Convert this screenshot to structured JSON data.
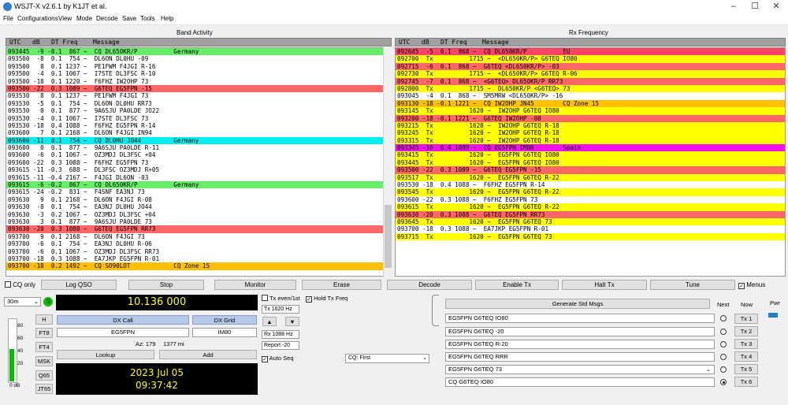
{
  "window": {
    "title": "WSJT-X  v2.6.1  by K1JT et al."
  },
  "menu": [
    "File",
    "Configurations",
    "View",
    "Mode",
    "Decode",
    "Save",
    "Tools",
    "Help"
  ],
  "band_activity": {
    "title": "Band Activity",
    "header": "UTC   dB   DT Freq    Message",
    "rows": [
      {
        "t": "093445  -9 -0.1  867 ~  CQ DL650KR/P          Germany",
        "c": "green"
      },
      {
        "t": "093500  -8  0.1  754 ~  DL6ON DL0HU -09",
        "c": ""
      },
      {
        "t": "093500   8  0.1 1237 ~  PE1FWM F4JGI R-16",
        "c": ""
      },
      {
        "t": "093500  -4  0.1 1067 ~  I7STE DL3FSC R-10",
        "c": ""
      },
      {
        "t": "093500 -18  0.1 1220 ~  F6FHZ IW2OHP 73",
        "c": ""
      },
      {
        "t": "093500 -22  0.3 1089 ~  G6TEQ EG5FPN -15",
        "c": "red"
      },
      {
        "t": "093530   8  0.1 1237 ~  PE1FWM F4JGI 73",
        "c": ""
      },
      {
        "t": "093530  -5  0.1  754 ~  DL6ON DL0HU RR73",
        "c": ""
      },
      {
        "t": "093530   0  0.1  877 ~  9A6SJU PA0LDE JO22",
        "c": ""
      },
      {
        "t": "093530  -4  0.1 1067 ~  I7STE DL3FSC 73",
        "c": ""
      },
      {
        "t": "093530 -18  0.4 1088 ~  F6FHZ EG5FPN R-14",
        "c": ""
      },
      {
        "t": "093600   7  0.1 2168 ~  DL6ON F4JGI IN94",
        "c": ""
      },
      {
        "t": "093600 -11  0.1  754 ~  CQ DL0HU JO44         Germany",
        "c": "cyan"
      },
      {
        "t": "093600   0  0.1  877 ~  9A6SJU PA0LDE R-11",
        "c": ""
      },
      {
        "t": "093600  -6  0.1 1067 ~  OZ3MDJ DL3FSC +04",
        "c": ""
      },
      {
        "t": "093600 -22  0.3 1088 ~  F6FHZ EG5FPN 73",
        "c": ""
      },
      {
        "t": "093615 -11 -0.3  688 ~  DL3FSC OZ3MDJ R+05",
        "c": ""
      },
      {
        "t": "093615 -11 -0.4 2167 ~  F4JGI DL6ON -03",
        "c": ""
      },
      {
        "t": "093615  -6 -0.2  867 ~  CQ DL650KR/P          Germany",
        "c": "green"
      },
      {
        "t": "093615 -24 -0.2  831 ~  F4SNF EA3NJ 73",
        "c": ""
      },
      {
        "t": "093630   9  0.1 2168 ~  DL6ON F4JGI R-08",
        "c": ""
      },
      {
        "t": "093630  -8  0.1  754 ~  EA3NJ DL0HU JO44",
        "c": ""
      },
      {
        "t": "093630  -3  0.2 1067 ~  OZ3MDJ DL3FSC +04",
        "c": ""
      },
      {
        "t": "093630   3  0.1  877 ~  9A6SJU PA0LDE 73",
        "c": ""
      },
      {
        "t": "093630 -20  0.3 1088 ~  G6TEQ EG5FPN RR73",
        "c": "red"
      },
      {
        "t": "093700   9  0.1 2168 ~  DL6ON F4JGI 73",
        "c": ""
      },
      {
        "t": "093700  -6  0.1  754 ~  EA3NJ DL0HU R-06",
        "c": ""
      },
      {
        "t": "093700  -6  0.1 1067 ~  OZ3MDJ DL3FSC RR73",
        "c": ""
      },
      {
        "t": "093700 -18  0.3 1088 ~  EA7JKP EG5FPN R-01",
        "c": ""
      },
      {
        "t": "093700 -18  0.2 1492 ~  CQ SO90LOT            CQ Zone 15",
        "c": "orange"
      }
    ]
  },
  "rx_frequency": {
    "title": "Rx Frequency",
    "header": "UTC   dB   DT Freq    Message",
    "rows": [
      {
        "t": "092645  -5  0.1  868 ~  CQ DL650KR/P          EU",
        "c": "pink"
      },
      {
        "t": "092700  Tx          1715 ~  <DL650KR/P> G6TEQ IO80",
        "c": "yellow"
      },
      {
        "t": "092715  -6  0.1  868 ~  G6TEQ <DL650KR/P> -03",
        "c": "red"
      },
      {
        "t": "092730  Tx          1715 ~  <DL650KR/P> G6TEQ R-06",
        "c": "yellow"
      },
      {
        "t": "092745  -7  0.1  868 ~  <G6TEQ> DL650KR/P RR73",
        "c": "red"
      },
      {
        "t": "092800  Tx          1715 ~  DL650KR/P <G6TEQ> 73",
        "c": "yellow"
      },
      {
        "t": "093045  -4  0.1  868 ~  SM5MRW <DL650KR/P> -16",
        "c": ""
      },
      {
        "t": "093130 -18 -0.1 1221 ~  CQ IW2OHP JN45        CQ Zone 15",
        "c": "orange"
      },
      {
        "t": "093145  Tx          1620 ~  IW2OHP G6TEQ IO80",
        "c": "yellow"
      },
      {
        "t": "093200 -18 -0.1 1221 ~  G6TEQ IW2OHP -08",
        "c": "red"
      },
      {
        "t": "093215  Tx          1620 ~  IW2OHP G6TEQ R-18",
        "c": "yellow"
      },
      {
        "t": "093245  Tx          1620 ~  IW2OHP G6TEQ R-18",
        "c": "yellow"
      },
      {
        "t": "093315  Tx          1620 ~  IW2OHP G6TEQ R-18",
        "c": "yellow"
      },
      {
        "t": "093345 -16  0.4 1089 ~  CQ EG5FPN IM80        Spain",
        "c": "magenta"
      },
      {
        "t": "093415  Tx          1620 ~  EG5FPN G6TEQ IO80",
        "c": "yellow"
      },
      {
        "t": "093445  Tx          1620 ~  EG5FPN G6TEQ IO80",
        "c": "yellow"
      },
      {
        "t": "093500 -22  0.3 1089 ~  G6TEQ EG5FPN -15",
        "c": "red"
      },
      {
        "t": "093517  Tx          1620 ~  EG5FPN G6TEQ R-22",
        "c": "yellow"
      },
      {
        "t": "093530 -18  0.4 1088 ~  F6FHZ EG5FPN R-14",
        "c": ""
      },
      {
        "t": "093545  Tx          1620 ~  EG5FPN G6TEQ R-22",
        "c": "yellow"
      },
      {
        "t": "093600 -22  0.3 1088 ~  F6FHZ EG5FPN 73",
        "c": ""
      },
      {
        "t": "093615  Tx          1620 ~  EG5FPN G6TEQ R-22",
        "c": "yellow"
      },
      {
        "t": "093630 -20  0.3 1088 ~  G6TEQ EG5FPN RR73",
        "c": "red"
      },
      {
        "t": "093645  Tx          1620 ~  EG5FPN G6TEQ 73",
        "c": "yellow"
      },
      {
        "t": "093700 -18  0.3 1088 ~  EA7JKP EG5FPN R-01",
        "c": ""
      },
      {
        "t": "093715  Tx          1620 ~  EG5FPN G6TEQ 73",
        "c": "yellow"
      }
    ]
  },
  "buttons": {
    "cq_only": "CQ only",
    "log_qso": "Log QSO",
    "stop": "Stop",
    "monitor": "Monitor",
    "erase": "Erase",
    "decode": "Decode",
    "enable_tx": "Enable Tx",
    "halt_tx": "Halt Tx",
    "tune": "Tune",
    "menus": "Menus"
  },
  "controls": {
    "band": "30m",
    "frequency": "10.136 000",
    "modes": [
      "H",
      "FT8",
      "FT4",
      "MSK",
      "Q65",
      "JT65"
    ],
    "meter_ticks": [
      "80",
      "60",
      "40",
      "20"
    ],
    "meter_value": "0 dB",
    "dx_call_label": "DX Call",
    "dx_grid_label": "DX Grid",
    "dx_call": "EG5FPN",
    "dx_grid": "IM80",
    "az": "Az: 179",
    "dist": "1377 mi",
    "lookup": "Lookup",
    "add": "Add",
    "date": "2023 Jul 05",
    "time": "09:37:42",
    "tx_even": "Tx even/1st",
    "hold_tx": "Hold Tx Freq",
    "tx_hz": "Tx  1620  Hz",
    "rx_hz": "Rx  1088  Hz",
    "report": "Report -20",
    "auto_seq": "Auto Seq",
    "cq_select": "CQ: First"
  },
  "std_msgs": {
    "generate": "Generate Std Msgs",
    "next_label": "Next",
    "now_label": "Now",
    "pwr_label": "Pwr",
    "messages": [
      "EG5FPN G6TEQ IO80",
      "EG5FPN G6TEQ -20",
      "EG5FPN G6TEQ R-20",
      "EG5FPN G6TEQ RRR",
      "EG5FPN G6TEQ 73",
      "CQ G6TEQ IO80"
    ],
    "tx_labels": [
      "Tx 1",
      "Tx 2",
      "Tx 3",
      "Tx 4",
      "Tx 5",
      "Tx 6"
    ],
    "selected": 5
  },
  "colors": {
    "accent_green": "#66ee66",
    "tx_yellow": "#ffff00",
    "my_call_red": "#ff6666",
    "cq_orange": "#ffc000"
  }
}
